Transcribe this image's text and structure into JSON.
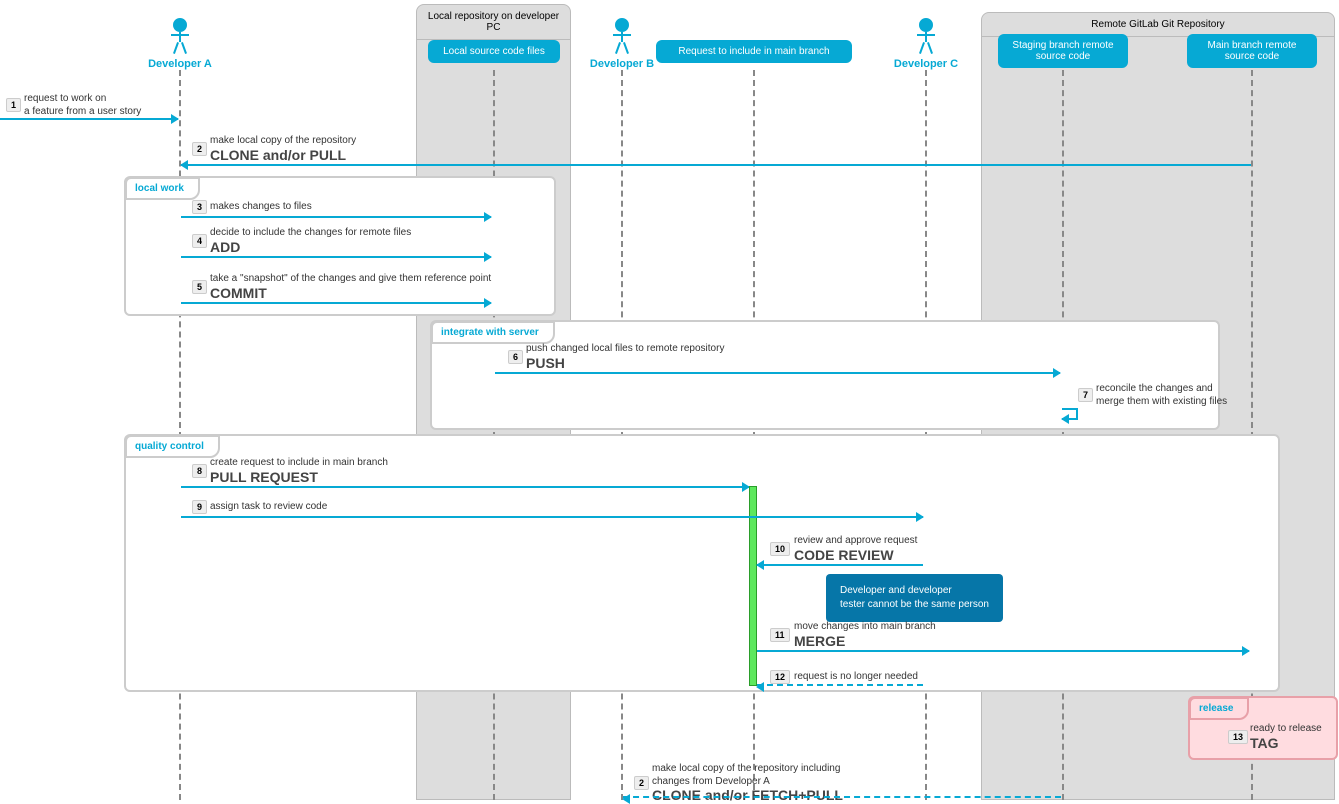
{
  "actors": {
    "devA": "Developer A",
    "devB": "Developer B",
    "devC": "Developer C"
  },
  "boxes": {
    "localRepo": {
      "title": "Local repository\non developer PC",
      "participant": "Local source code files"
    },
    "remoteRepo": {
      "title": "Remote GitLab Git Repository",
      "staging": "Staging branch\nremote source code",
      "main": "Main branch\nremote source code"
    }
  },
  "request": "Request to include in main branch",
  "frames": {
    "localWork": "local work",
    "integrate": "integrate with server",
    "quality": "quality control",
    "release": "release"
  },
  "steps": {
    "s1": {
      "n": "1",
      "text": "request to work on\na feature from a user story"
    },
    "s2": {
      "n": "2",
      "text": "make local copy of the repository",
      "big": "CLONE and/or PULL"
    },
    "s3": {
      "n": "3",
      "text": "makes changes to files"
    },
    "s4": {
      "n": "4",
      "text": "decide to include the changes for remote files",
      "big": "ADD"
    },
    "s5": {
      "n": "5",
      "text": "take a \"snapshot\" of the changes and give them reference point",
      "big": "COMMIT"
    },
    "s6": {
      "n": "6",
      "text": "push changed local files to remote repository",
      "big": "PUSH"
    },
    "s7": {
      "n": "7",
      "text": "reconcile the changes and\nmerge them with existing files"
    },
    "s8": {
      "n": "8",
      "text": "create request to include in main branch",
      "big": "PULL REQUEST"
    },
    "s9": {
      "n": "9",
      "text": "assign task to review code"
    },
    "s10": {
      "n": "10",
      "text": "review and approve request",
      "big": "CODE REVIEW"
    },
    "s11": {
      "n": "11",
      "text": "move changes into main branch",
      "big": "MERGE"
    },
    "s12": {
      "n": "12",
      "text": "request is no longer needed"
    },
    "s13": {
      "n": "13",
      "text": "ready to release",
      "big": "TAG"
    },
    "s14": {
      "n": "2",
      "text": "make local copy of the repository including\nchanges from Developer A",
      "big": "CLONE and/or FETCH+PULL"
    }
  },
  "note": "Developer and developer\ntester cannot be the same person"
}
